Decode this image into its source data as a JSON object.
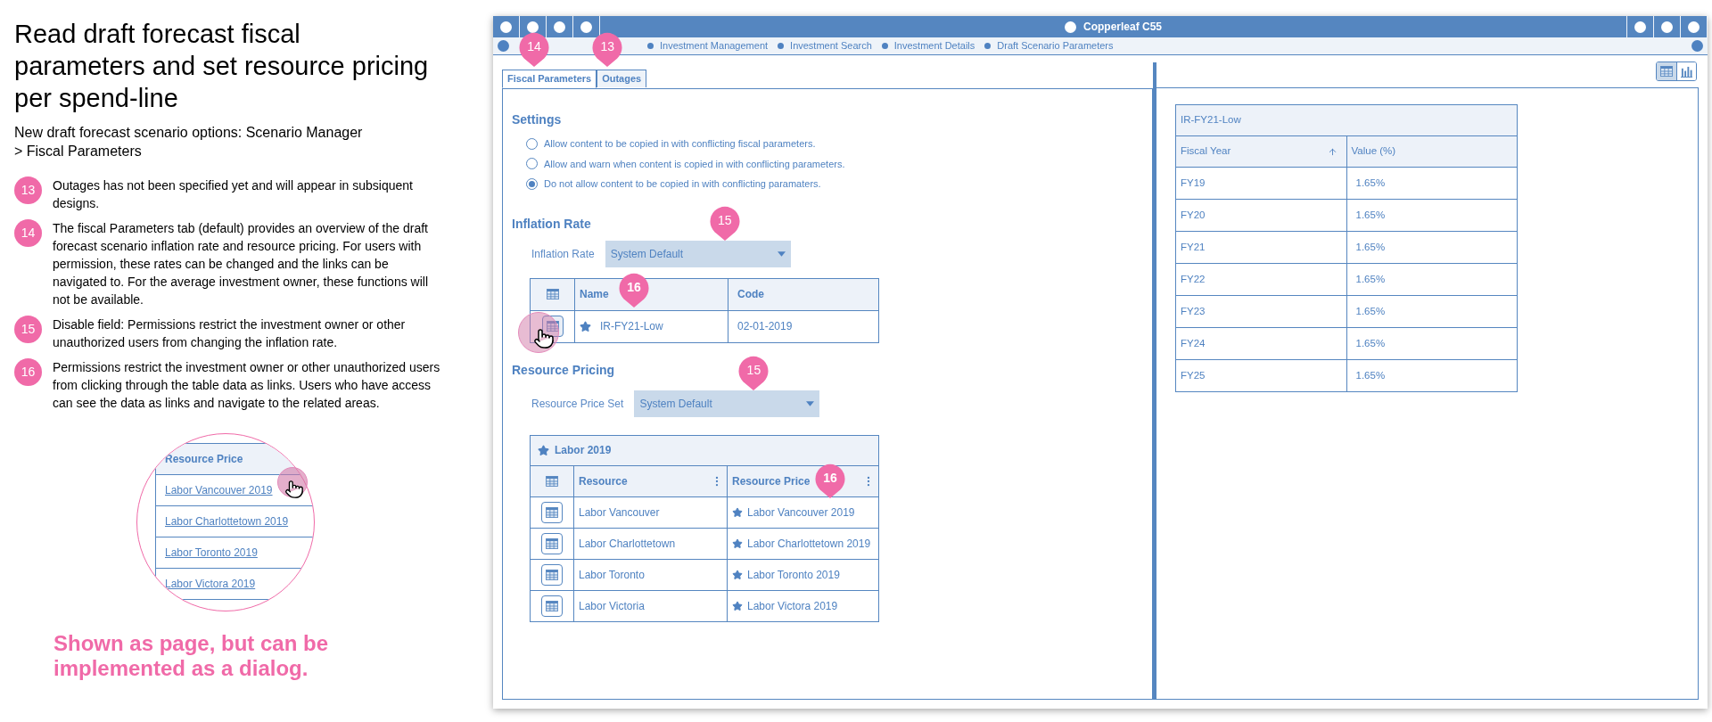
{
  "annotation": {
    "title": "Read draft forecast fiscal parameters and set resource pricing per spend-line",
    "subtitle": "New draft forecast scenario options: Scenario Manager > Fiscal Parameters",
    "notes": [
      {
        "number": "13",
        "text": "Outages has not been specified yet and will appear in subsiquent designs."
      },
      {
        "number": "14",
        "text": "The fiscal Parameters tab (default) provides an overview of the draft forecast scenario inflation rate and resource pricing. For users with permission, these rates can be changed and the links can be navigated to. For the average investment owner, these functions will not be available."
      },
      {
        "number": "15",
        "text": "Disable field: Permissions restrict the investment owner or other unauthorized users from changing the inflation rate."
      },
      {
        "number": "16",
        "text": "Permissions restrict the investment owner or other unauthorized users from clicking through the table data as links. Users who have access can see the data as links and navigate to the related areas."
      }
    ],
    "magnifier": {
      "header": "Resource Price",
      "links": [
        "Labor Vancouver 2019",
        "Labor Charlottetown 2019",
        "Labor Toronto 2019",
        "Labor Victora 2019"
      ]
    },
    "footer": "Shown as page, but can be implemented as a dialog."
  },
  "window": {
    "title": "Copperleaf C55"
  },
  "breadcrumb": [
    "Investment Management",
    "Investment Search",
    "Investment Details",
    "Draft Scenario Parameters"
  ],
  "tabs": [
    {
      "label": "Fiscal Parameters",
      "selected": true,
      "pin": "14"
    },
    {
      "label": "Outages",
      "selected": false,
      "pin": "13"
    }
  ],
  "settings": {
    "heading": "Settings",
    "options": [
      {
        "label": "Allow content to be copied in with conflicting fiscal parameters.",
        "selected": false
      },
      {
        "label": "Allow and warn when content is copied in with conflicting parameters.",
        "selected": false
      },
      {
        "label": "Do not allow content to be copied in with conflicting paramaters.",
        "selected": true
      }
    ]
  },
  "inflation": {
    "heading": "Inflation Rate",
    "field_label": "Inflation Rate",
    "value": "System Default",
    "disabled": true,
    "pin": "15",
    "table": {
      "columns": [
        "Name",
        "Code"
      ],
      "header_pin": "16",
      "rows": [
        {
          "name": "IR-FY21-Low",
          "code": "02-01-2019"
        }
      ]
    }
  },
  "resource_pricing": {
    "heading": "Resource Pricing",
    "field_label": "Resource Price Set",
    "value": "System Default",
    "disabled": true,
    "pin": "15",
    "table": {
      "caption": "Labor 2019",
      "columns": [
        "Resource",
        "Resource Price"
      ],
      "header_pin": "16",
      "rows": [
        {
          "resource": "Labor Vancouver",
          "price": "Labor Vancouver 2019"
        },
        {
          "resource": "Labor Charlottetown",
          "price": "Labor Charlottetown 2019"
        },
        {
          "resource": "Labor Toronto",
          "price": "Labor Toronto 2019"
        },
        {
          "resource": "Labor Victoria",
          "price": "Labor Victora 2019"
        }
      ]
    }
  },
  "view_toggle": [
    {
      "kind": "table",
      "selected": true
    },
    {
      "kind": "chart",
      "selected": false
    }
  ],
  "rate_table": {
    "caption": "IR-FY21-Low",
    "columns": [
      {
        "label": "Fiscal Year",
        "sorted": true
      },
      {
        "label": "Value (%)",
        "sorted": false
      }
    ],
    "rows": [
      {
        "year": "FY19",
        "value": "1.65%"
      },
      {
        "year": "FY20",
        "value": "1.65%"
      },
      {
        "year": "FY21",
        "value": "1.65%"
      },
      {
        "year": "FY22",
        "value": "1.65%"
      },
      {
        "year": "FY23",
        "value": "1.65%"
      },
      {
        "year": "FY24",
        "value": "1.65%"
      },
      {
        "year": "FY25",
        "value": "1.65%"
      }
    ]
  }
}
